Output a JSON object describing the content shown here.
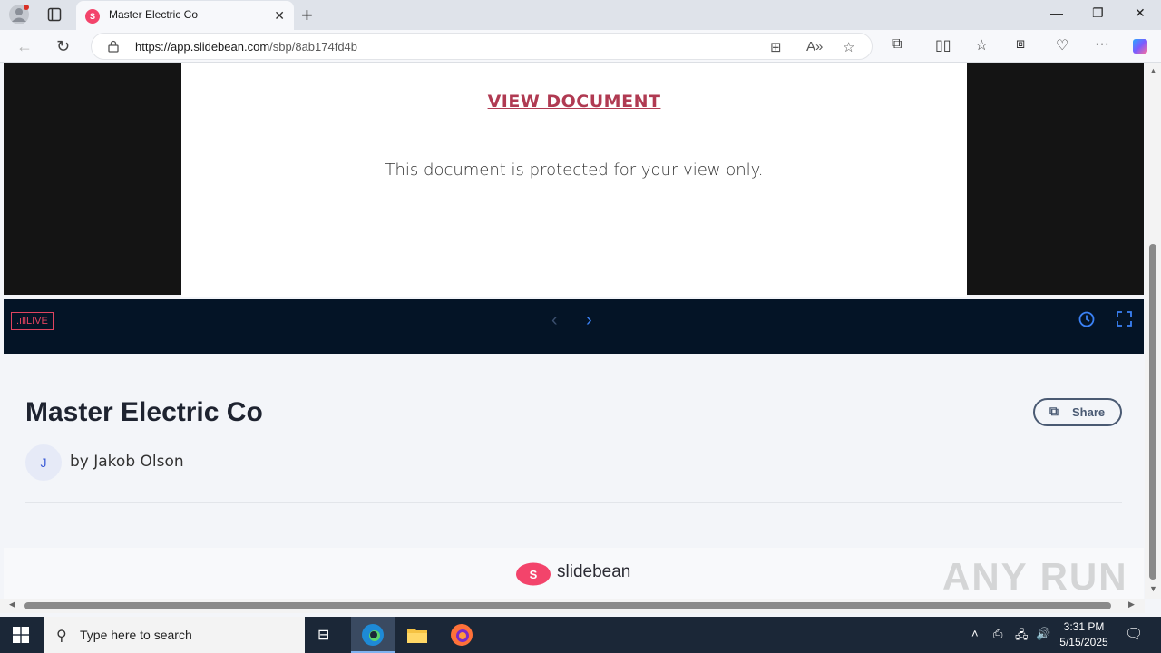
{
  "browser": {
    "tab_title": "Master Electric Co",
    "tab_favicon_letter": "S",
    "url_host": "https://app.slidebean.com",
    "url_path": "/sbp/8ab174fd4b"
  },
  "slide": {
    "link_text": "VIEW DOCUMENT",
    "message": "This document is protected for your view only."
  },
  "controls": {
    "live_label": "LIVE"
  },
  "presentation": {
    "title": "Master Electric Co",
    "share_label": "Share",
    "avatar_initial": "J",
    "author": "by Jakob Olson"
  },
  "footer": {
    "brand_name": "slidebean",
    "brand_letter": "S",
    "watermark": "ANY RUN"
  },
  "taskbar": {
    "search_placeholder": "Type here to search",
    "time": "3:31 PM",
    "date": "5/15/2025"
  },
  "colors": {
    "accent": "#b03a52",
    "brand": "#f3446b",
    "controls_bg": "#041426",
    "control_icon": "#3b82f6"
  }
}
